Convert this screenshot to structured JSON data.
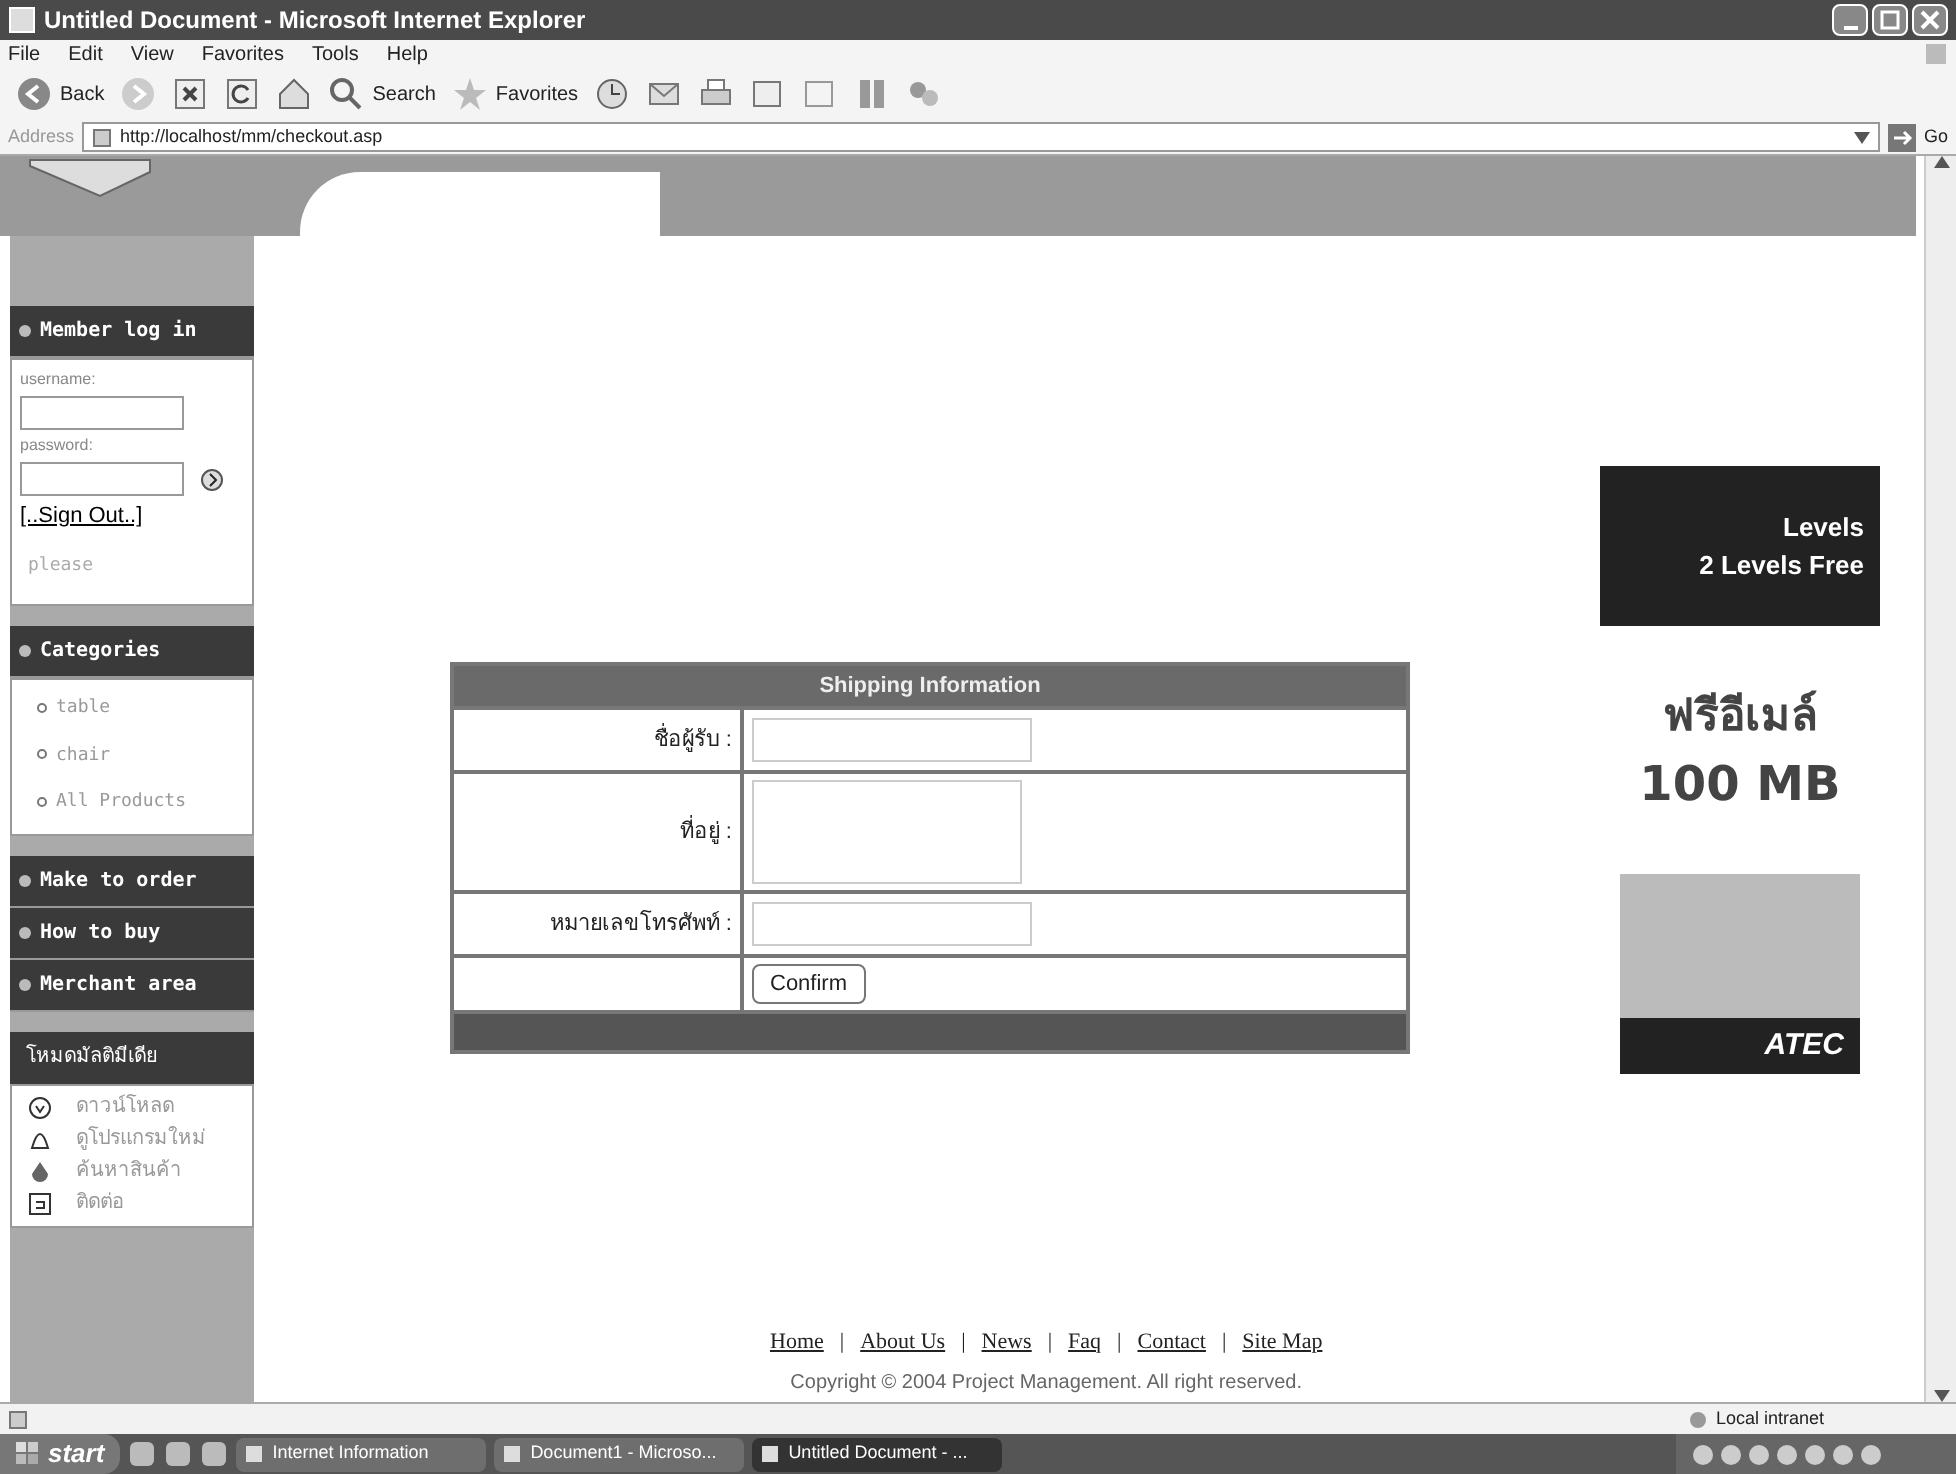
{
  "window": {
    "title": "Untitled Document - Microsoft Internet Explorer"
  },
  "menu": [
    "File",
    "Edit",
    "View",
    "Favorites",
    "Tools",
    "Help"
  ],
  "toolbar": [
    {
      "kind": "back",
      "label": "Back"
    },
    {
      "kind": "forward"
    },
    {
      "kind": "stop"
    },
    {
      "kind": "refresh"
    },
    {
      "kind": "home"
    },
    {
      "kind": "search",
      "label": "Search"
    },
    {
      "kind": "favorites",
      "label": "Favorites"
    },
    {
      "kind": "history"
    },
    {
      "kind": "mail"
    },
    {
      "kind": "print"
    },
    {
      "kind": "edit"
    },
    {
      "kind": "discuss"
    },
    {
      "kind": "research"
    },
    {
      "kind": "messenger"
    }
  ],
  "address": {
    "label": "Address",
    "value": "http://localhost/mm/checkout.asp",
    "go": "Go"
  },
  "sidebar": {
    "login": {
      "title": "Member log in",
      "username_label": "username:",
      "password_label": "password:",
      "sign_out": "[..Sign Out..]",
      "note": "please"
    },
    "categories": {
      "title": "Categories",
      "items": [
        "table",
        "chair",
        "All Products"
      ]
    },
    "links": [
      "Make to order",
      "How to buy",
      "Merchant area"
    ],
    "extra": {
      "title": "โหมดมัลติมีเดีย",
      "items": [
        {
          "kind": "clock",
          "label": "ดาวน์โหลด"
        },
        {
          "kind": "bell",
          "label": "ดูโปรแกรมใหม่"
        },
        {
          "kind": "drop",
          "label": "ค้นหาสินค้า"
        },
        {
          "kind": "box",
          "label": "ติดต่อ"
        }
      ]
    }
  },
  "form": {
    "title": "Shipping Information",
    "fields": [
      {
        "kind": "text",
        "label": "ชื่อผู้รับ :"
      },
      {
        "kind": "textarea",
        "label": "ที่อยู่ :"
      },
      {
        "kind": "text",
        "label": "หมายเลขโทรศัพท์ :"
      }
    ],
    "button": "Confirm"
  },
  "ads": [
    {
      "kind": "levels",
      "lines": [
        "Levels",
        "2 Levels Free"
      ]
    },
    {
      "kind": "mail",
      "lines": [
        "ฟรีอีเมล์",
        "100 MB"
      ]
    },
    {
      "kind": "brand",
      "lines": [
        "ATEC"
      ]
    }
  ],
  "footer": {
    "separator": "|",
    "links": [
      "Home",
      "About Us",
      "News",
      "Faq",
      "Contact",
      "Site Map"
    ],
    "copyright": "Copyright © 2004 Project Management. All right reserved."
  },
  "status_bar": {
    "zone": "Local intranet"
  },
  "taskbar": {
    "start": "start",
    "tasks": [
      {
        "label": "Internet Information",
        "selected": false
      },
      {
        "label": "Document1 - Microso...",
        "selected": false
      },
      {
        "label": "Untitled Document - ...",
        "selected": true
      }
    ]
  }
}
